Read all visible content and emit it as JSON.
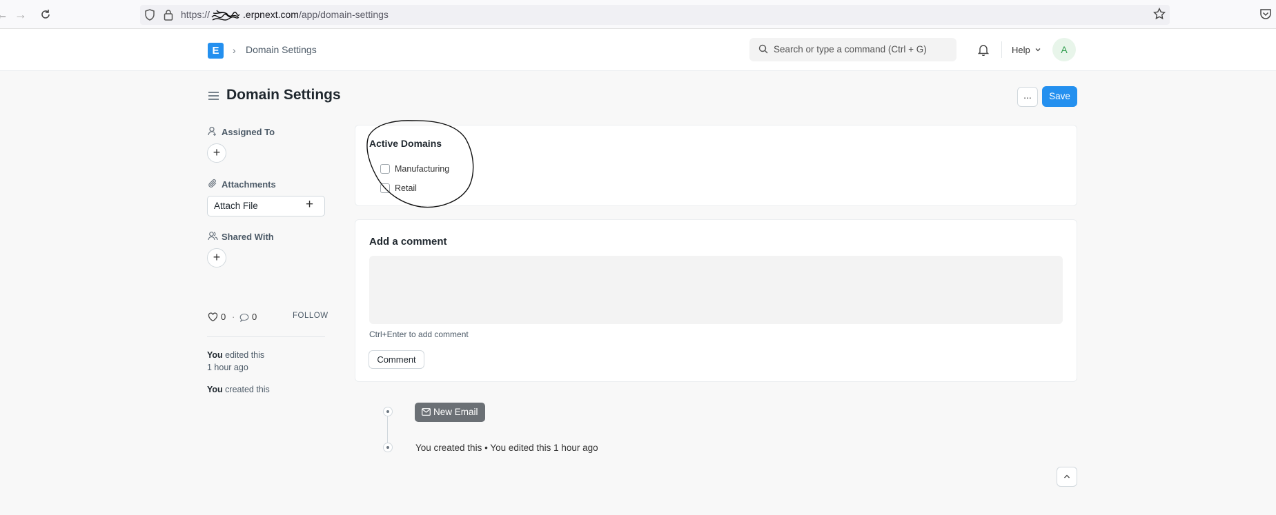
{
  "browser": {
    "url_prefix": "https://",
    "url_host": ".erpnext.com",
    "url_path": "/app/domain-settings"
  },
  "navbar": {
    "logo_letter": "E",
    "breadcrumb": "Domain Settings",
    "search_placeholder": "Search or type a command (Ctrl + G)",
    "help_label": "Help",
    "avatar_letter": "A"
  },
  "page": {
    "title": "Domain Settings",
    "more_label": "...",
    "save_label": "Save"
  },
  "sidebar": {
    "assigned_to": "Assigned To",
    "attachments": "Attachments",
    "attach_file": "Attach File",
    "shared_with": "Shared With",
    "likes": "0",
    "separator": "·",
    "comments": "0",
    "follow": "FOLLOW",
    "activity": [
      {
        "who": "You",
        "what": " edited this",
        "when": "1 hour ago"
      },
      {
        "who": "You",
        "what": " created this",
        "when": ""
      }
    ]
  },
  "domains": {
    "title": "Active Domains",
    "options": [
      {
        "label": "Manufacturing",
        "checked": false
      },
      {
        "label": "Retail",
        "checked": false
      }
    ]
  },
  "comment": {
    "title": "Add a comment",
    "hint": "Ctrl+Enter to add comment",
    "button": "Comment"
  },
  "timeline": {
    "new_email": "New Email",
    "entry": "You created this • You edited this 1 hour ago"
  },
  "colors": {
    "primary": "#2490ef",
    "email_button": "#6b7075"
  },
  "icons": [
    "back-arrow-icon",
    "forward-arrow-icon",
    "reload-icon",
    "shield-icon",
    "lock-icon",
    "star-icon",
    "pocket-icon",
    "search-icon",
    "bell-icon",
    "chevron-down-icon",
    "menu-icon",
    "user-icon",
    "paperclip-icon",
    "people-icon",
    "heart-icon",
    "comment-icon",
    "mail-icon",
    "chevron-up-icon"
  ]
}
